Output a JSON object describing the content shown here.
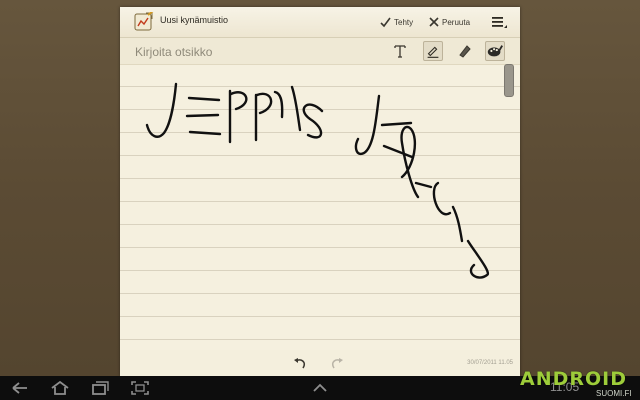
{
  "app": {
    "title": "Uusi kynämuistio",
    "done_label": "Tehty",
    "cancel_label": "Peruuta"
  },
  "toolbar": {
    "title_placeholder": "Kirjoita otsikko",
    "tools": [
      "text-tool",
      "pen-tool",
      "eraser-tool",
      "palette-tool"
    ]
  },
  "note": {
    "timestamp": "30/07/2011 11.05"
  },
  "system": {
    "clock": "11:05",
    "brand_main": "ANDROID",
    "brand_sub": "SUOMI.FI"
  },
  "colors": {
    "paper": "#f4efdd",
    "ink": "#111111",
    "wallpaper": "#5a4b35",
    "system_bar": "#0d0d0d",
    "brand": "#9dcc3a"
  }
}
